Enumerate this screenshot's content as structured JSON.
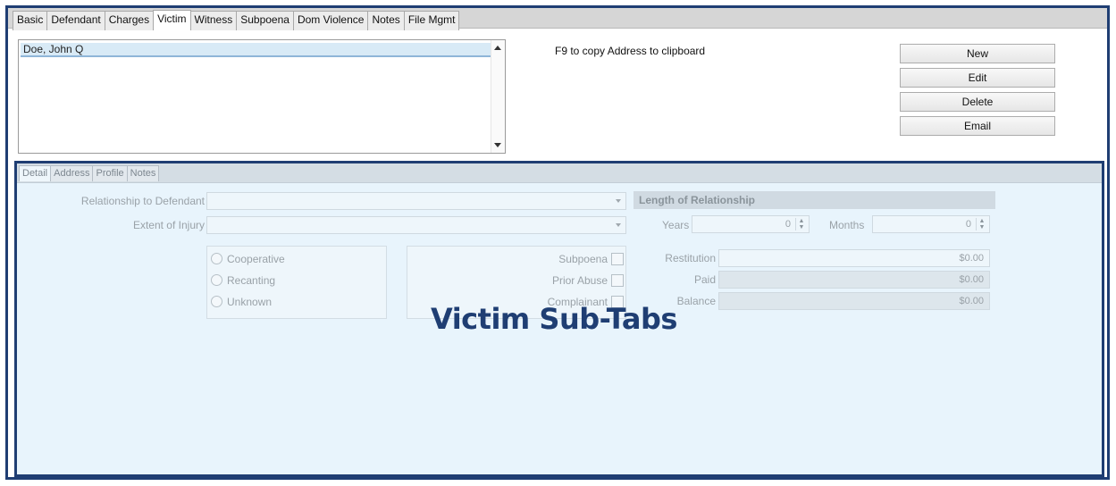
{
  "top_tabs": [
    "Basic",
    "Defendant",
    "Charges",
    "Victim",
    "Witness",
    "Subpoena",
    "Dom Violence",
    "Notes",
    "File Mgmt"
  ],
  "victims": [
    "Doe, John Q"
  ],
  "hint": "F9 to copy Address to clipboard",
  "buttons": {
    "new": "New",
    "edit": "Edit",
    "delete": "Delete",
    "email": "Email"
  },
  "sub_tabs": [
    "Detail",
    "Address",
    "Profile",
    "Notes"
  ],
  "detail": {
    "relationship_label": "Relationship to Defendant",
    "relationship_value": "",
    "injury_label": "Extent of Injury",
    "injury_value": "",
    "length_header": "Length of Relationship",
    "years_label": "Years",
    "years_value": "0",
    "months_label": "Months",
    "months_value": "0",
    "radios": [
      "Cooperative",
      "Recanting",
      "Unknown"
    ],
    "checks": [
      "Subpoena",
      "Prior Abuse",
      "Complainant"
    ],
    "restitution_label": "Restitution",
    "restitution_value": "$0.00",
    "paid_label": "Paid",
    "paid_value": "$0.00",
    "balance_label": "Balance",
    "balance_value": "$0.00"
  },
  "overlay_label": "Victim Sub-Tabs",
  "colors": {
    "frame": "#1f3e73",
    "panel": "#e8f4fc"
  }
}
